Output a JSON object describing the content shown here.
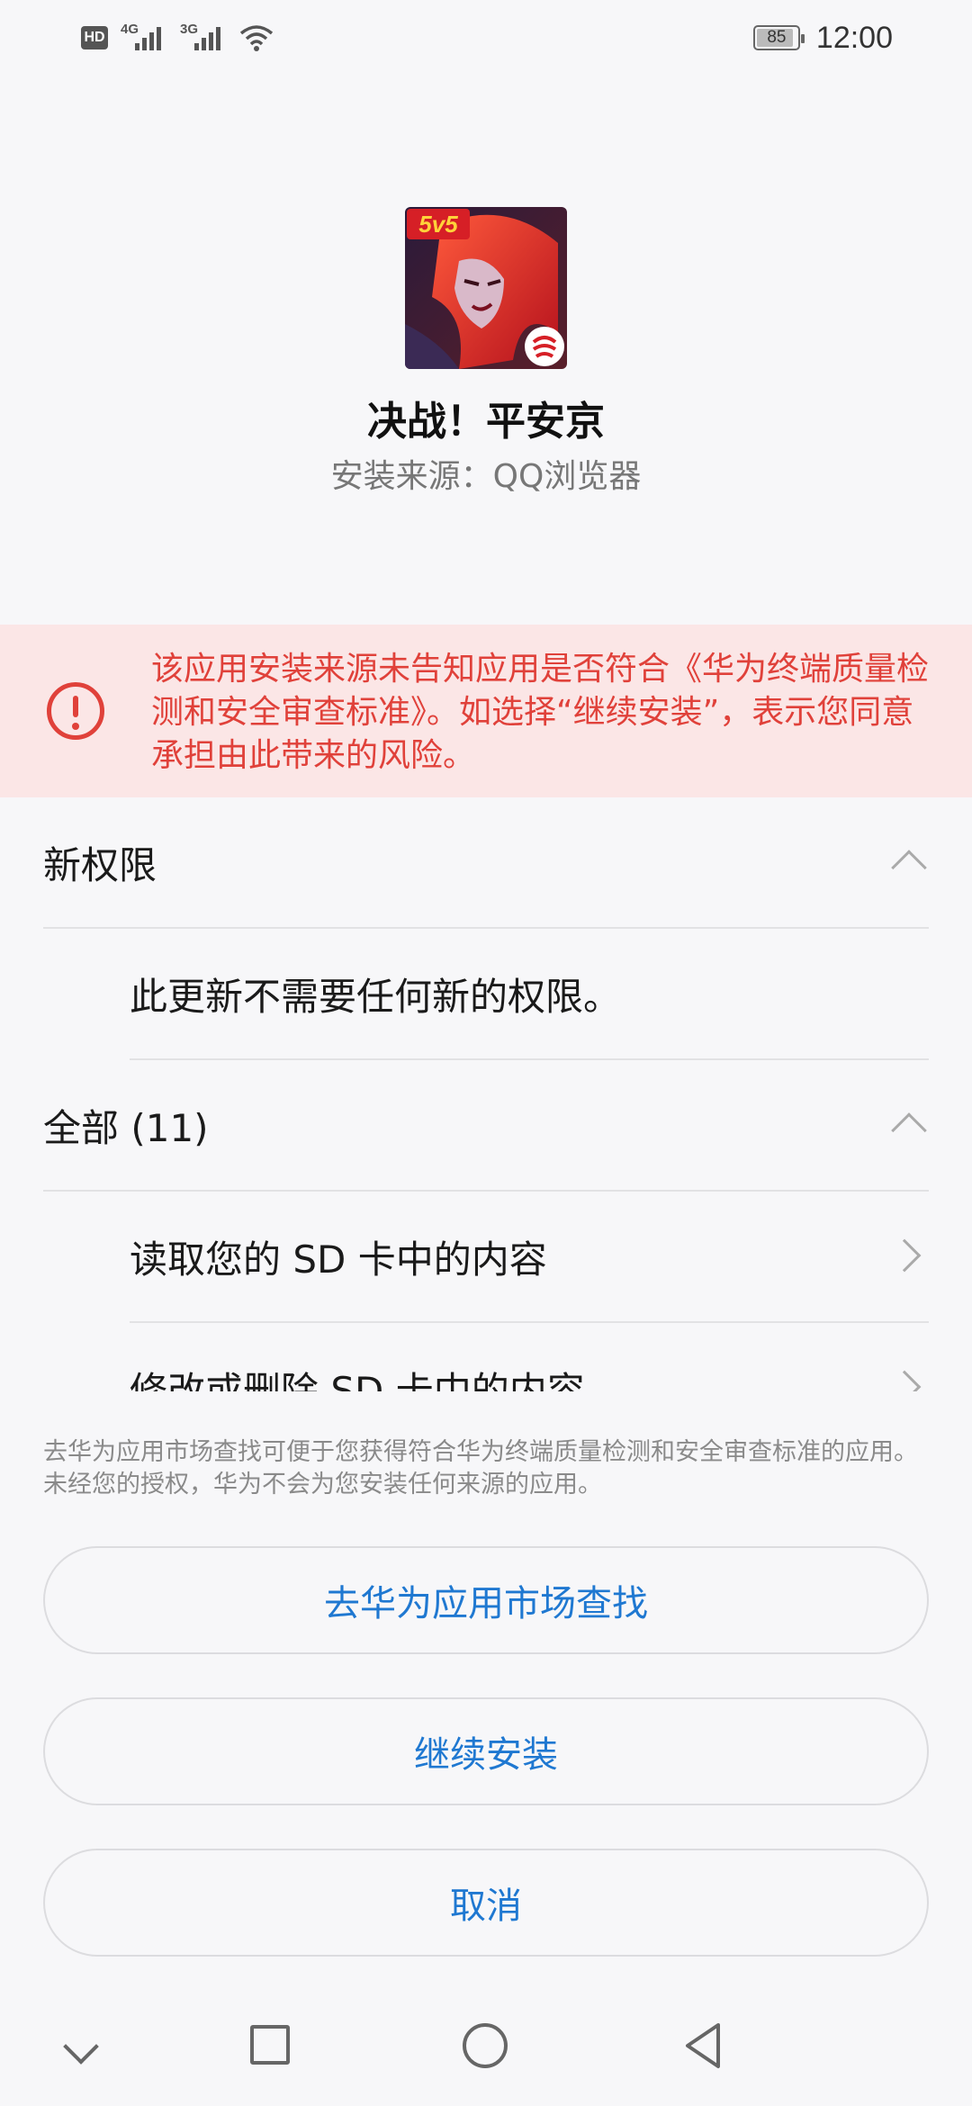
{
  "status_bar": {
    "hd": "HD",
    "sim1_gen": "4G",
    "sim2_gen": "3G",
    "battery": "85",
    "time": "12:00"
  },
  "app": {
    "icon": "app-icon",
    "icon_badge_text": "5v5",
    "name": "决战！平安京",
    "source": "安装来源：QQ浏览器"
  },
  "warning": {
    "icon": "warning-icon",
    "color": "#e0413a",
    "background": "#fbe6e6",
    "text": "该应用安装来源未告知应用是否符合《华为终端质量检测和安全审查标准》。如选择“继续安装”，表示您同意承担由此带来的风险。"
  },
  "permissions": {
    "new_section": {
      "label": "新权限",
      "rows": [
        {
          "text": "此更新不需要任何新的权限。"
        }
      ]
    },
    "all_section": {
      "label": "全部 (11)",
      "rows": [
        {
          "text": "读取您的 SD 卡中的内容"
        },
        {
          "text": "修改或删除 SD 卡中的内容"
        }
      ]
    }
  },
  "footer": {
    "note": "去华为应用市场查找可便于您获得符合华为终端质量检测和安全审查标准的应用。未经您的授权，华为不会为您安装任何来源的应用。",
    "buttons": {
      "find_in_market": "去华为应用市场查找",
      "continue_install": "继续安装",
      "cancel": "取消"
    },
    "button_text_color": "#1f78d1"
  },
  "nav_bar": {
    "icons": [
      "chevron-down-icon",
      "recents-square-icon",
      "home-circle-icon",
      "back-triangle-icon"
    ]
  }
}
